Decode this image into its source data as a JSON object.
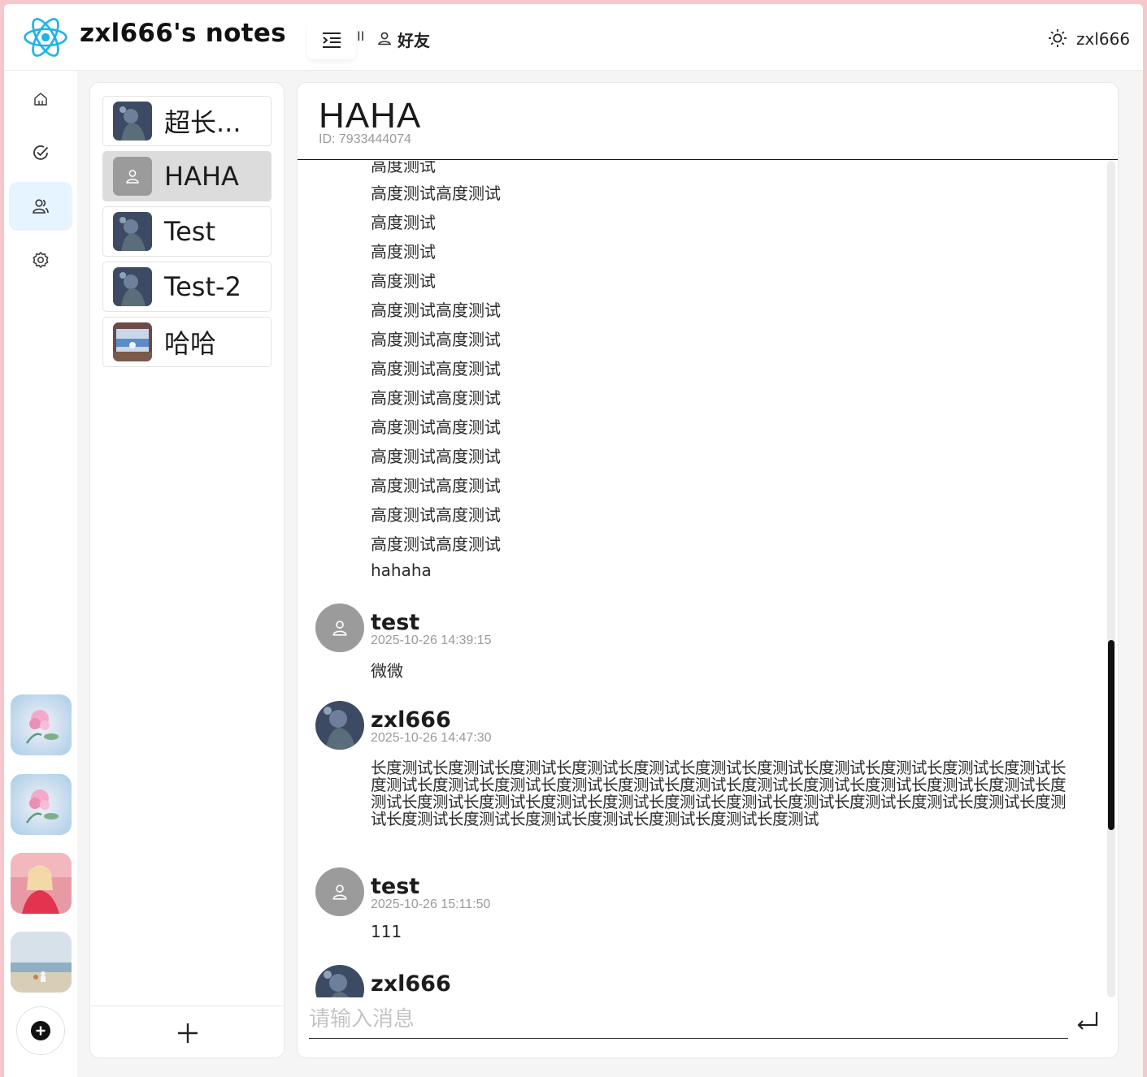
{
  "app": {
    "title": "zxl666's notes"
  },
  "header": {
    "divider_mark": "II",
    "breadcrumb": "好友",
    "user_name": "zxl666"
  },
  "nav": {
    "items": [
      {
        "icon": "home-icon"
      },
      {
        "icon": "check-circle-icon"
      },
      {
        "icon": "users-icon",
        "active": true
      },
      {
        "icon": "gear-icon"
      }
    ],
    "shortcuts": [
      "flower-thumbnail",
      "flower-thumbnail",
      "portrait-thumbnail",
      "beach-thumbnail"
    ],
    "add_icon": "plus-circle-icon"
  },
  "friends": {
    "list": [
      {
        "name": "超长..."
      },
      {
        "name": "HAHA",
        "active": true
      },
      {
        "name": "Test"
      },
      {
        "name": "Test-2"
      },
      {
        "name": "哈哈"
      }
    ],
    "add_icon": "plus-icon"
  },
  "chat": {
    "name": "HAHA",
    "id_text": "ID: 7933444074",
    "lines": [
      "高度测试",
      "高度测试高度测试",
      "高度测试",
      "高度测试",
      "高度测试",
      "高度测试高度测试",
      "高度测试高度测试",
      "高度测试高度测试",
      "高度测试高度测试",
      "高度测试高度测试",
      "高度测试高度测试",
      "高度测试高度测试",
      "高度测试高度测试",
      "高度测试高度测试",
      "hahaha"
    ],
    "messages": [
      {
        "user": "test",
        "time": "2025-10-26 14:39:15",
        "text": "微微"
      },
      {
        "user": "zxl666",
        "time": "2025-10-26 14:47:30",
        "text": "长度测试长度测试长度测试长度测试长度测试长度测试长度测试长度测试长度测试长度测试长度测试长度测试长度测试长度测试长度测试长度测试长度测试长度测试长度测试长度测试长度测试长度测试长度测试长度测试长度测试长度测试长度测试长度测试长度测试长度测试长度测试长度测试长度测试长度测试长度测试长度测试长度测试长度测试长度测试长度测试长度测试"
      },
      {
        "user": "test",
        "time": "2025-10-26 15:11:50",
        "text": "111"
      },
      {
        "user": "zxl666"
      }
    ],
    "input_placeholder": "请输入消息",
    "send_icon": "enter-icon"
  },
  "colors": {
    "accent": "#1fb3e8",
    "active_nav": "#e6f4ff",
    "active_friend": "#dcdcdc",
    "frame": "#f7c8cb"
  }
}
